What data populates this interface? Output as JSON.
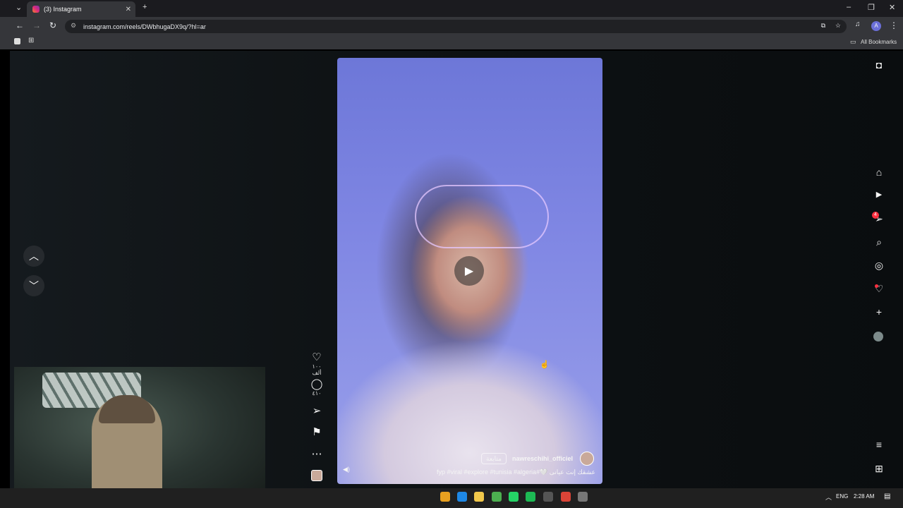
{
  "browser": {
    "tab_title": "(3) Instagram",
    "url": "instagram.com/reels/DWbhugaDX9q/?hl=ar",
    "bookmarks_label": "All Bookmarks",
    "profile_initial": "A"
  },
  "reel": {
    "username": "nawreschihi_officiel",
    "follow_label": "متابعة",
    "caption": "fyp #viral #explore #tunisia #algeria#🤍 عشقك إنت عيانى",
    "likes": "١٠٠ ألف",
    "comments": "٤١٠"
  },
  "icons": {
    "play": "▶",
    "heart": "♡",
    "comment": "◯",
    "share": "➢",
    "save": "⚑",
    "more": "⋯",
    "home": "⌂",
    "reels": "▶",
    "messages": "➢",
    "search": "⌕",
    "explore": "◎",
    "notifications": "♡",
    "create": "+",
    "menu": "≡",
    "apps": "⊞",
    "up": "︿",
    "down": "﹀",
    "mute": "🔇"
  },
  "badges": {
    "messages_count": "4"
  },
  "taskbar": {
    "lang": "ENG",
    "time": "2:28 AM"
  },
  "colors": {
    "badge": "#ff3040",
    "accent": "#0095f6"
  }
}
